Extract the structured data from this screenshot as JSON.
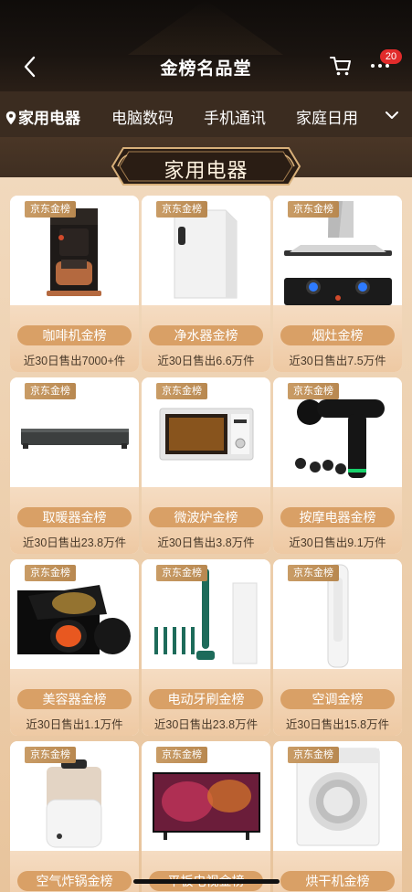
{
  "header": {
    "title": "金榜名品堂",
    "cart_badge": "20"
  },
  "tabs": [
    {
      "label": "家用电器",
      "active": true
    },
    {
      "label": "电脑数码",
      "active": false
    },
    {
      "label": "手机通讯",
      "active": false
    },
    {
      "label": "家庭日用",
      "active": false
    }
  ],
  "section": {
    "title": "家用电器"
  },
  "tag_text": "京东金榜",
  "products": [
    {
      "name": "咖啡机金榜",
      "sales": "近30日售出7000+件",
      "icon": "coffee-machine-icon"
    },
    {
      "name": "净水器金榜",
      "sales": "近30日售出6.6万件",
      "icon": "water-purifier-icon"
    },
    {
      "name": "烟灶金榜",
      "sales": "近30日售出7.5万件",
      "icon": "range-hood-stove-icon"
    },
    {
      "name": "取暖器金榜",
      "sales": "近30日售出23.8万件",
      "icon": "heater-icon"
    },
    {
      "name": "微波炉金榜",
      "sales": "近30日售出3.8万件",
      "icon": "microwave-icon"
    },
    {
      "name": "按摩电器金榜",
      "sales": "近30日售出9.1万件",
      "icon": "massage-gun-icon"
    },
    {
      "name": "美容器金榜",
      "sales": "近30日售出1.1万件",
      "icon": "beauty-device-icon"
    },
    {
      "name": "电动牙刷金榜",
      "sales": "近30日售出23.8万件",
      "icon": "electric-toothbrush-icon"
    },
    {
      "name": "空调金榜",
      "sales": "近30日售出15.8万件",
      "icon": "air-conditioner-icon"
    },
    {
      "name": "空气炸锅金榜",
      "sales": "",
      "icon": "air-fryer-icon"
    },
    {
      "name": "平板电视金榜",
      "sales": "",
      "icon": "flat-tv-icon"
    },
    {
      "name": "烘干机金榜",
      "sales": "",
      "icon": "dryer-icon"
    }
  ],
  "colors": {
    "header_bg": "#0f0c0a",
    "accent": "#d9a066",
    "badge": "#e12b2b"
  }
}
